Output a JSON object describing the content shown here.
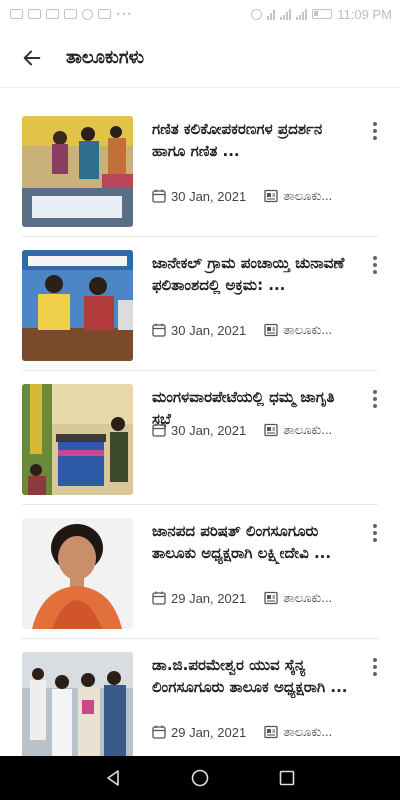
{
  "status_bar": {
    "time": "11:09 PM"
  },
  "header": {
    "title": "ತಾಲೂಕುಗಳು"
  },
  "articles": [
    {
      "title": "ಗಣಿತ ಕಲಿಕೋಪಕರಣಗಳ ಪ್ರದರ್ಶನ ಹಾಗೂ ಗಣಿತ ...",
      "date": "30 Jan, 2021",
      "category": "ತಾಲೂಕು..."
    },
    {
      "title": "ಜಾನೇಕಲ್ ಗ್ರಾಮ ಪಂಚಾಯ್ತಿ ಚುನಾವಣೆ ಫಲಿತಾಂಶದಲ್ಲಿ ಅಕ್ರಮ: ...",
      "date": "30 Jan, 2021",
      "category": "ತಾಲೂಕು..."
    },
    {
      "title": "ಮಂಗಳವಾರಪೇಟೆಯಲ್ಲಿ ಧಮ್ಮ ಜಾಗೃತಿ ಸಭೆ",
      "date": "30 Jan, 2021",
      "category": "ತಾಲೂಕು..."
    },
    {
      "title": "ಜಾನಪದ ಪರಿಷತ್ ಲಿಂಗಸೂಗೂರು ತಾಲೂಕು ಅಧ್ಯಕ್ಷರಾಗಿ ಲಕ್ಷ್ಮೀದೇವಿ ...",
      "date": "29 Jan, 2021",
      "category": "ತಾಲೂಕು..."
    },
    {
      "title": "ಡಾ.ಜಿ.ಪರಮೇಶ್ವರ ಯುವ ಸೈನ್ಯ ಲಿಂಗಸೂಗೂರು ತಾಲೂಕ ಅಧ್ಯಕ್ಷರಾಗಿ ...",
      "date": "29 Jan, 2021",
      "category": "ತಾಲೂಕು..."
    }
  ],
  "colors": {
    "accent_text": "#1e1e1e",
    "status_icons": "#c4c4c4",
    "nav_bar": "#000000"
  }
}
